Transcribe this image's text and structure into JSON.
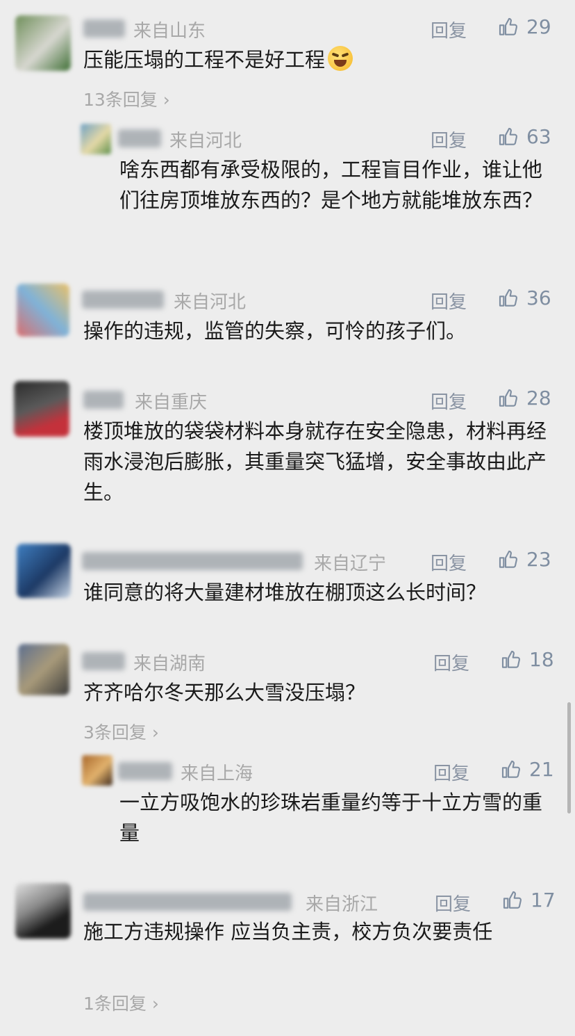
{
  "reply_label": "回复",
  "comments": [
    {
      "location": "来自山东",
      "likes": "29",
      "text": "压能压塌的工程不是好工程",
      "more_replies": "13条回复",
      "avatar_colors": [
        "#6f8f5a",
        "#d7d7d0",
        "#3f6f35"
      ],
      "emoji": "crying-laughing-emoji"
    },
    {
      "location": "来自河北",
      "likes": "63",
      "text": "啥东西都有承受极限的，工程盲目作业，谁让他们往房顶堆放东西的？是个地方就能堆放东西？",
      "avatar_colors": [
        "#6fa1c4",
        "#e5d9a7",
        "#5d8f4a"
      ]
    },
    {
      "location": "来自河北",
      "likes": "36",
      "text": "操作的违规，监管的失察，可怜的孩子们。",
      "avatar_colors": [
        "#d96f6f",
        "#7fb2d8",
        "#e8c06a"
      ]
    },
    {
      "location": "来自重庆",
      "likes": "28",
      "text": "楼顶堆放的袋袋材料本身就存在安全隐患，材料再经雨水浸泡后膨胀，其重量突飞猛增，安全事故由此产生。",
      "avatar_colors": [
        "#2b2b2b",
        "#c4313b",
        "#5a5a5a"
      ]
    },
    {
      "location": "来自辽宁",
      "likes": "23",
      "text": "谁同意的将大量建材堆放在棚顶这么长时间？",
      "avatar_colors": [
        "#3f7fc1",
        "#1d3a66",
        "#c9d6e6"
      ]
    },
    {
      "location": "来自湖南",
      "likes": "18",
      "text": "齐齐哈尔冬天那么大雪没压塌？",
      "more_replies": "3条回复",
      "avatar_colors": [
        "#5d6f8f",
        "#a89a7a",
        "#3a3a3a"
      ]
    },
    {
      "location": "来自上海",
      "likes": "21",
      "text": "一立方吸饱水的珍珠岩重量约等于十立方雪的重量",
      "avatar_colors": [
        "#a8672b",
        "#e2b26d",
        "#3e2a1c"
      ]
    },
    {
      "location": "来自浙江",
      "likes": "17",
      "text": "施工方违规操作 应当负主责，校方负次要责任",
      "more_replies": "1条回复",
      "avatar_colors": [
        "#1c1c1c",
        "#8a8a8a",
        "#e0e0e0"
      ]
    }
  ]
}
